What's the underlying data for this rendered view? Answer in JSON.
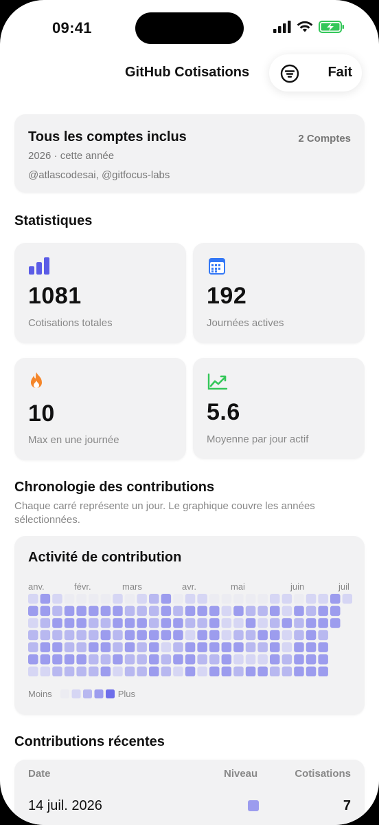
{
  "status": {
    "time": "09:41"
  },
  "nav": {
    "title": "GitHub Cotisations",
    "done_label": "Fait"
  },
  "accounts": {
    "title": "Tous les comptes inclus",
    "count": "2 Comptes",
    "year": "2026 · cette année",
    "users": "@atlascodesai, @gitfocus-labs"
  },
  "stats": {
    "heading": "Statistiques",
    "items": [
      {
        "icon": "bar-chart-icon",
        "value": "1081",
        "label": "Cotisations totales",
        "color": "#5b5ce6"
      },
      {
        "icon": "calendar-icon",
        "value": "192",
        "label": "Journées actives",
        "color": "#3478f6"
      },
      {
        "icon": "flame-icon",
        "value": "10",
        "label": "Max en une journée",
        "color": "#f5862a"
      },
      {
        "icon": "trend-up-icon",
        "value": "5.6",
        "label": "Moyenne par jour actif",
        "color": "#34c759"
      }
    ]
  },
  "timeline": {
    "heading": "Chronologie des contributions",
    "subtitle": "Chaque carré représente un jour. Le graphique couvre les années sélectionnées."
  },
  "activity": {
    "title": "Activité de contribution",
    "months": [
      "anv.",
      "févr.",
      "mars",
      "avr.",
      "mai",
      "juin",
      "juil"
    ],
    "legend_less": "Moins",
    "legend_more": "Plus",
    "level_colors": [
      "#ececf2",
      "#d6d6f4",
      "#b8b8f0",
      "#9c9cee",
      "#6e6eea"
    ]
  },
  "recent": {
    "heading": "Contributions récentes",
    "columns": [
      "Date",
      "Niveau",
      "Cotisations"
    ],
    "rows": [
      {
        "date": "14 juil. 2026",
        "level": 3,
        "count": "7"
      }
    ]
  }
}
